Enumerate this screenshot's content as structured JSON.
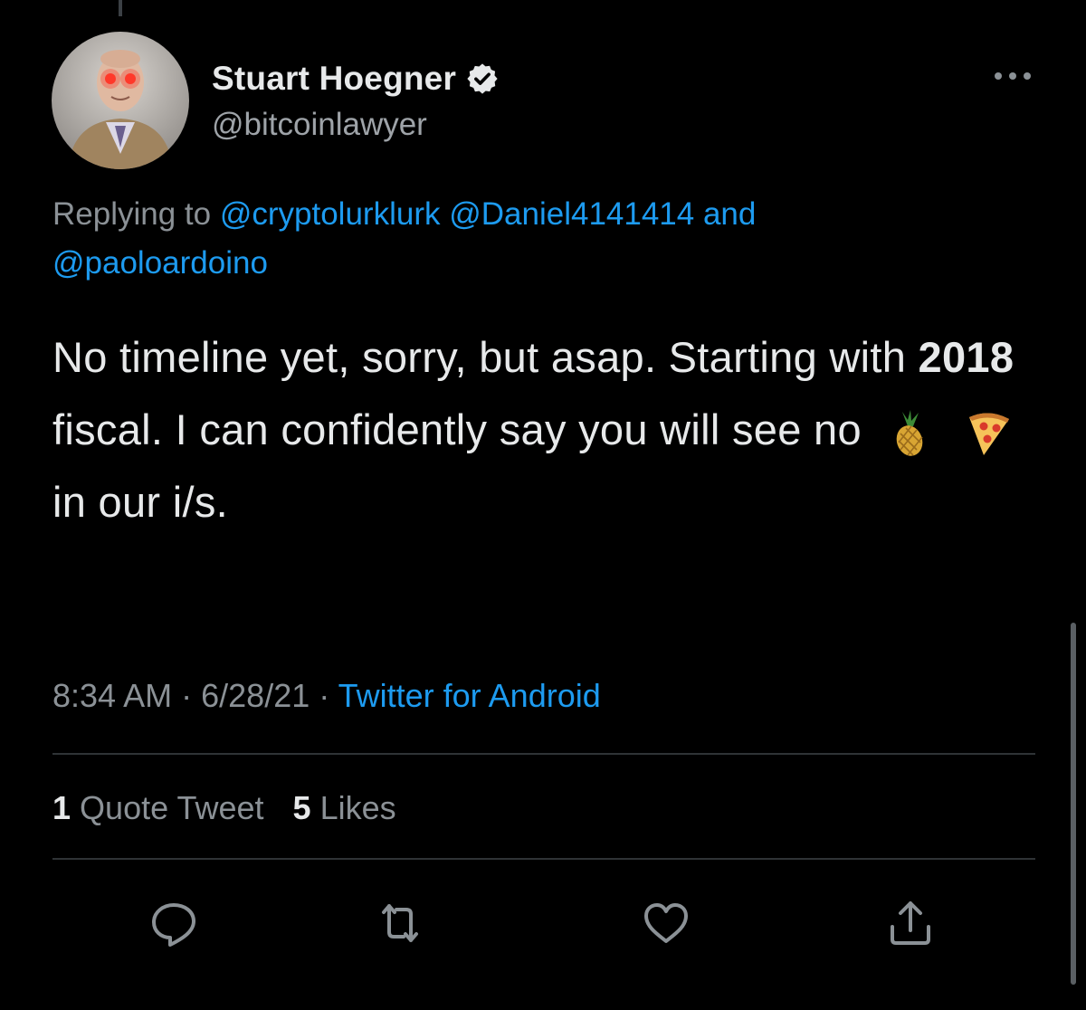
{
  "tweet": {
    "author": {
      "display_name": "Stuart Hoegner",
      "handle": "@bitcoinlawyer",
      "verified": true
    },
    "replying_to": {
      "prefix": "Replying to",
      "mentions": [
        "@cryptolurklurk",
        "@Daniel4141414"
      ],
      "conjunction": "and",
      "last_mention": "@paoloardoino"
    },
    "text": {
      "part1": "No timeline yet, sorry, but asap. Starting with",
      "bold": "2018",
      "part2": "fiscal. I can confidently say you will see no",
      "emojis": [
        "pineapple-emoji",
        "pizza-emoji"
      ],
      "part3": "in our i/s."
    },
    "meta": {
      "time": "8:34 AM",
      "separator": "·",
      "date": "6/28/21",
      "source": "Twitter for Android"
    },
    "stats": {
      "quote_count": "1",
      "quote_label": "Quote Tweet",
      "like_count": "5",
      "like_label": "Likes"
    },
    "actions": [
      "reply-icon",
      "retweet-icon",
      "like-icon",
      "share-icon"
    ]
  },
  "colors": {
    "background": "#000000",
    "text": "#e7e9ea",
    "secondary": "#8b9196",
    "link": "#1d9bf0",
    "divider": "#2f3336"
  }
}
